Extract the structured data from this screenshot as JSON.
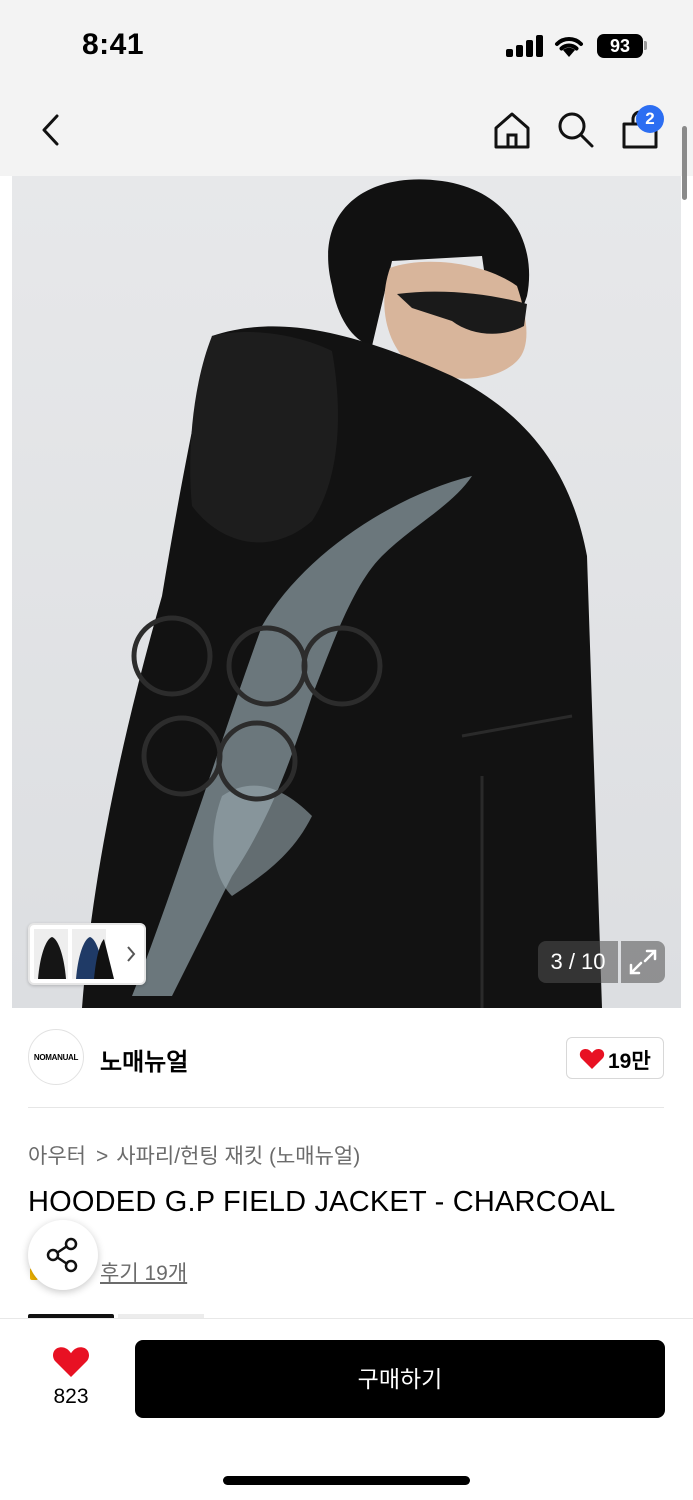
{
  "status_bar": {
    "time": "8:41",
    "battery": "93"
  },
  "nav": {
    "back_icon": "chevron-left-icon",
    "home_icon": "home-icon",
    "search_icon": "search-icon",
    "cart_icon": "shopping-bag-icon",
    "cart_count": "2"
  },
  "gallery": {
    "counter": "3 / 10",
    "expand_icon": "expand-icon"
  },
  "brand": {
    "logo_text": "NOMANUAL",
    "name": "노매뉴얼",
    "likes": "19만"
  },
  "breadcrumb": {
    "category": "아우터",
    "subcategory": "사파리/헌팅 재킷 (노매뉴얼)"
  },
  "product": {
    "title": "HOODED G.P FIELD JACKET - CHARCOAL",
    "reviews": "후기 19개"
  },
  "bottom_bar": {
    "like_count": "823",
    "buy_label": "구매하기"
  },
  "colors": {
    "accent_badge": "#2c6ef2",
    "heart": "#e81123",
    "button": "#000000"
  }
}
